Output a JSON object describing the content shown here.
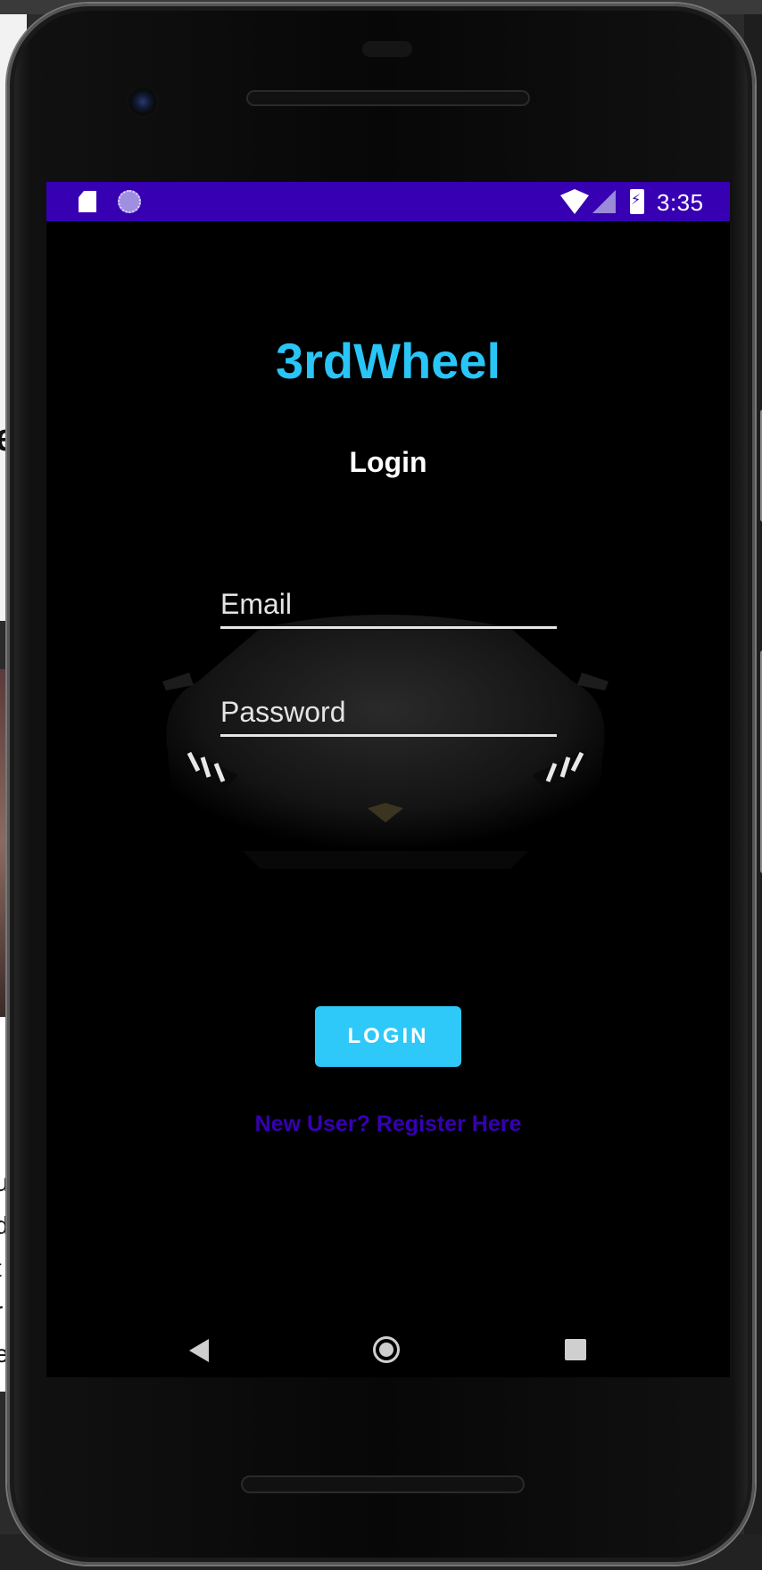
{
  "status_bar": {
    "time": "3:35",
    "icons": [
      "sd-card-icon",
      "sync-icon",
      "wifi-icon",
      "cell-signal-icon",
      "battery-charging-icon"
    ],
    "color": "#3700b3"
  },
  "app": {
    "title": "3rdWheel",
    "title_color": "#29c5f6",
    "heading": "Login"
  },
  "form": {
    "email_placeholder": "Email",
    "password_placeholder": "Password",
    "login_label": "LOGIN",
    "login_color": "#2ec9f8",
    "register_link": "New User? Register Here",
    "register_color": "#3700b3"
  },
  "nav_bar": {
    "buttons": [
      "back-icon",
      "home-icon",
      "recents-icon"
    ]
  },
  "backdrop_fragments": [
    "e",
    "u",
    "d",
    "t",
    "r",
    "e"
  ]
}
